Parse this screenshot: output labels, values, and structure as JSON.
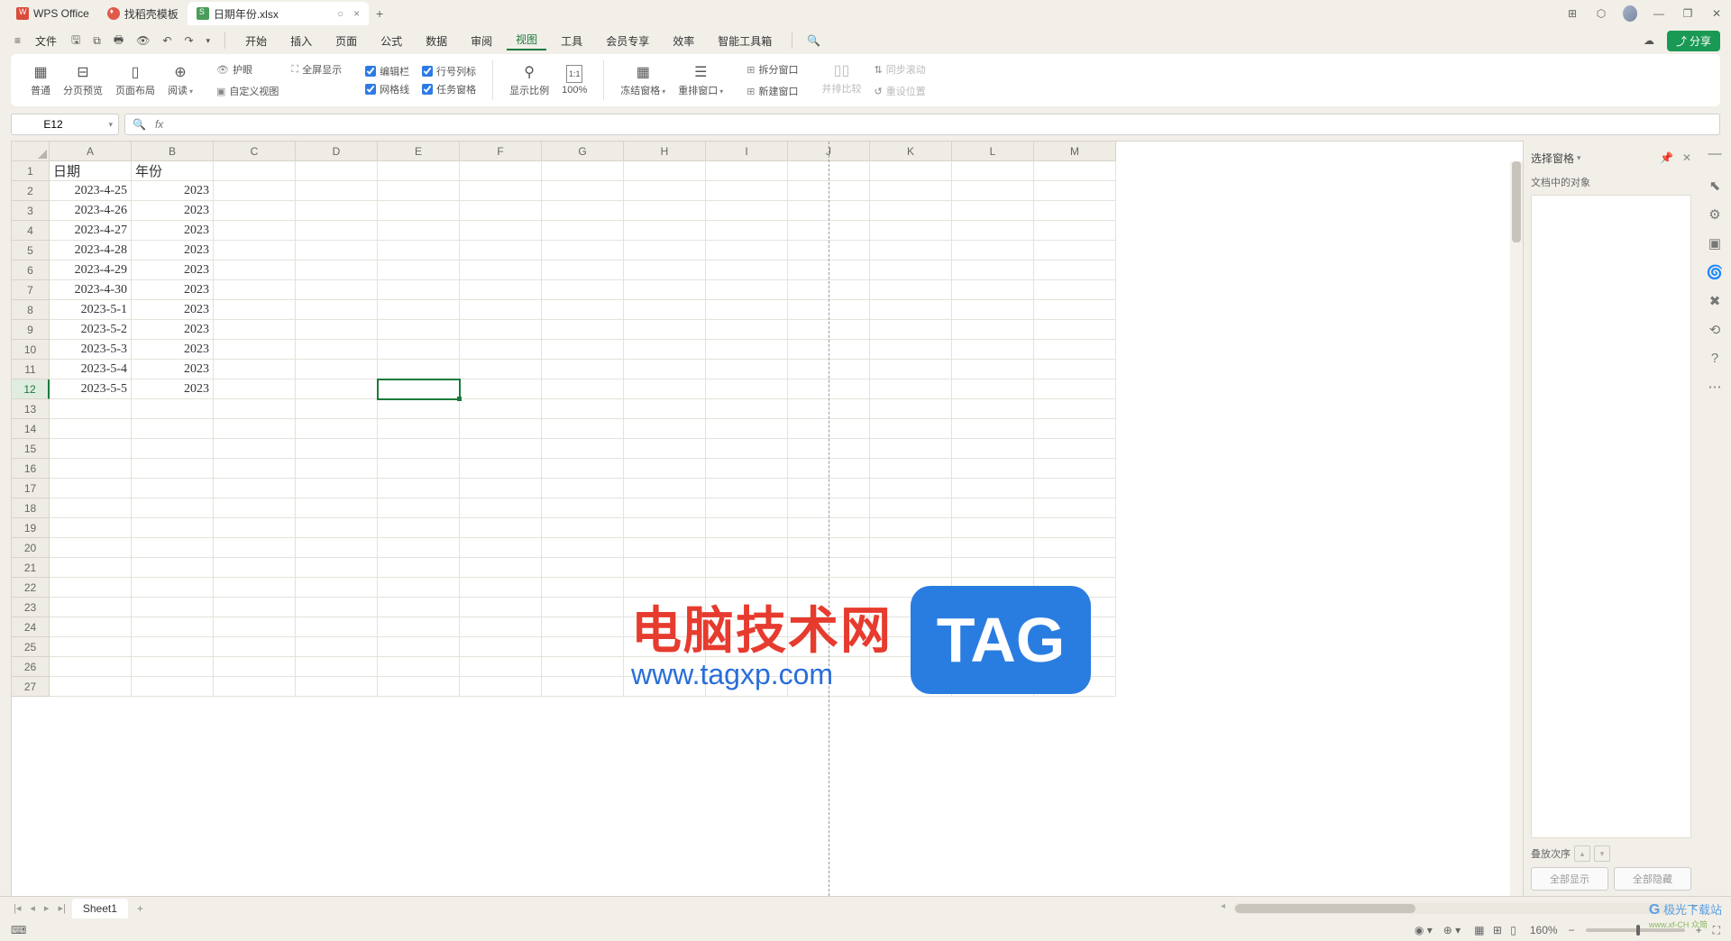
{
  "tabs": {
    "wps": "WPS Office",
    "template": "找稻壳模板",
    "file": "日期年份.xlsx",
    "status": "○",
    "close": "×"
  },
  "window_controls": {
    "layout": "⊞",
    "cube": "⬡",
    "min": "—",
    "max": "❐",
    "close": "✕"
  },
  "menubar": {
    "file": "文件",
    "items": [
      "开始",
      "插入",
      "页面",
      "公式",
      "数据",
      "审阅",
      "视图",
      "工具",
      "会员专享",
      "效率",
      "智能工具箱"
    ],
    "active_index": 6,
    "cloud": "☁",
    "share": "分享"
  },
  "ribbon": {
    "normal": "普通",
    "page_preview": "分页预览",
    "page_layout": "页面布局",
    "read": "阅读",
    "eye_protect": "护眼",
    "fullscreen": "全屏显示",
    "custom_view": "自定义视图",
    "edit_bar": "编辑栏",
    "row_col": "行号列标",
    "gridlines": "网格线",
    "task_pane": "任务窗格",
    "zoom": "显示比例",
    "pct100": "100%",
    "freeze": "冻结窗格",
    "rearrange": "重排窗口",
    "split": "拆分窗口",
    "new_window": "新建窗口",
    "side_by_side": "并排比较",
    "sync_scroll": "同步滚动",
    "reset_pos": "重设位置"
  },
  "namebox": "E12",
  "fx": "fx",
  "columns": [
    "A",
    "B",
    "C",
    "D",
    "E",
    "F",
    "G",
    "H",
    "I",
    "J",
    "K",
    "L",
    "M"
  ],
  "headers": {
    "date": "日期",
    "year": "年份"
  },
  "rows": [
    {
      "date": "2023-4-25",
      "year": "2023"
    },
    {
      "date": "2023-4-26",
      "year": "2023"
    },
    {
      "date": "2023-4-27",
      "year": "2023"
    },
    {
      "date": "2023-4-28",
      "year": "2023"
    },
    {
      "date": "2023-4-29",
      "year": "2023"
    },
    {
      "date": "2023-4-30",
      "year": "2023"
    },
    {
      "date": "2023-5-1",
      "year": "2023"
    },
    {
      "date": "2023-5-2",
      "year": "2023"
    },
    {
      "date": "2023-5-3",
      "year": "2023"
    },
    {
      "date": "2023-5-4",
      "year": "2023"
    },
    {
      "date": "2023-5-5",
      "year": "2023"
    }
  ],
  "total_visible_rows": 27,
  "selected": {
    "col": "E",
    "row": 12
  },
  "panel": {
    "title": "选择窗格",
    "subtitle": "文档中的对象",
    "stack_order": "叠放次序",
    "show_all": "全部显示",
    "hide_all": "全部隐藏"
  },
  "sheet": {
    "name": "Sheet1"
  },
  "status": {
    "icon": "⌨",
    "zoom": "160%"
  },
  "watermark": {
    "title": "电脑技术网",
    "url": "www.tagxp.com",
    "tag": "TAG",
    "site": "极光下载站",
    "siteurl": "www.xf-CH 众简"
  }
}
